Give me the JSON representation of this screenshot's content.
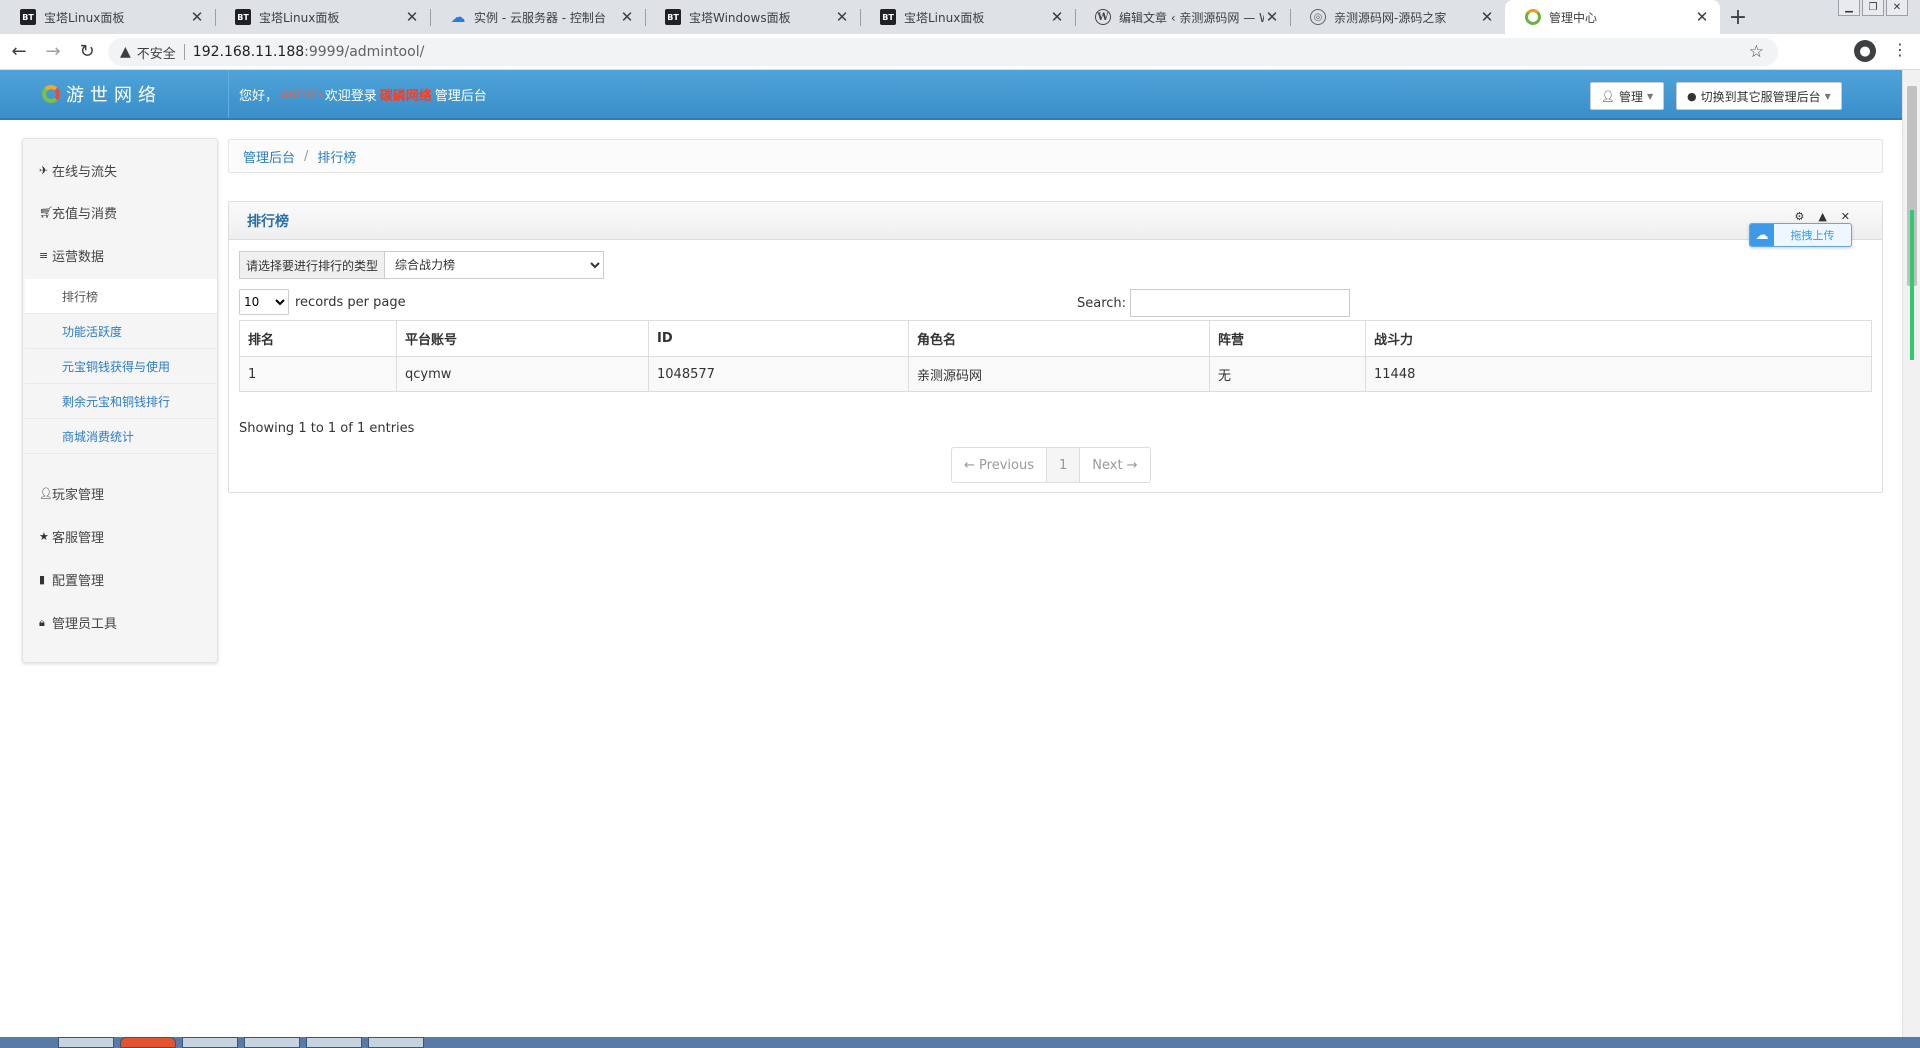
{
  "browser": {
    "tabs": [
      {
        "title": "宝塔Linux面板",
        "favicon": "bt-icon"
      },
      {
        "title": "宝塔Linux面板",
        "favicon": "bt-icon"
      },
      {
        "title": "实例 - 云服务器 - 控制台",
        "favicon": "cloud-icon"
      },
      {
        "title": "宝塔Windows面板",
        "favicon": "bt-icon"
      },
      {
        "title": "宝塔Linux面板",
        "favicon": "bt-icon"
      },
      {
        "title": "编辑文章 ‹ 亲测源码网 — W",
        "favicon": "wordpress-icon"
      },
      {
        "title": "亲测源码网-源码之家",
        "favicon": "globe-icon"
      },
      {
        "title": "管理中心",
        "favicon": "site-logo-icon",
        "active": true
      }
    ],
    "favicon_text": {
      "bt": "BT",
      "wp": "W",
      "globe": "◎"
    },
    "address": {
      "security_label": "不安全",
      "host": "192.168.11.188",
      "rest": ":9999/admintool/"
    }
  },
  "header": {
    "brand": "游世网络",
    "welcome_prefix": "您好，",
    "username": "admin",
    "welcome_mid": "欢迎登录",
    "server_name": "碳磷网络",
    "welcome_suffix": "管理后台",
    "admin_button": "管理",
    "switch_button": "切换到其它服管理后台"
  },
  "sidebar": {
    "items": [
      {
        "label": "在线与流失",
        "icon": "plane-icon"
      },
      {
        "label": "充值与消费",
        "icon": "cart-icon"
      },
      {
        "label": "运营数据",
        "icon": "list-icon"
      },
      {
        "label": "玩家管理",
        "icon": "user-icon"
      },
      {
        "label": "客服管理",
        "icon": "star-icon"
      },
      {
        "label": "配置管理",
        "icon": "book-icon"
      },
      {
        "label": "管理员工具",
        "icon": "lock-icon"
      }
    ],
    "submenu": [
      {
        "label": "排行榜",
        "active": true
      },
      {
        "label": "功能活跃度"
      },
      {
        "label": "元宝铜钱获得与使用"
      },
      {
        "label": "剩余元宝和铜钱排行"
      },
      {
        "label": "商城消费统计"
      }
    ]
  },
  "breadcrumb": {
    "root": "管理后台",
    "separator": "/",
    "current": "排行榜"
  },
  "panel": {
    "title": "排行榜",
    "type_label": "请选择要进行排行的类型",
    "type_selected": "综合战力榜",
    "length_value": "10",
    "length_suffix": "records per page",
    "search_label": "Search:",
    "search_value": "",
    "upload_label": "拖拽上传",
    "columns": [
      "排名",
      "平台账号",
      "ID",
      "角色名",
      "阵营",
      "战斗力"
    ],
    "rows": [
      [
        "1",
        "qcymw",
        "1048577",
        "亲测源码网",
        "无",
        "11448"
      ]
    ],
    "info": "Showing 1 to 1 of 1 entries",
    "pager": {
      "prev": "← Previous",
      "page": "1",
      "next": "Next →"
    }
  }
}
